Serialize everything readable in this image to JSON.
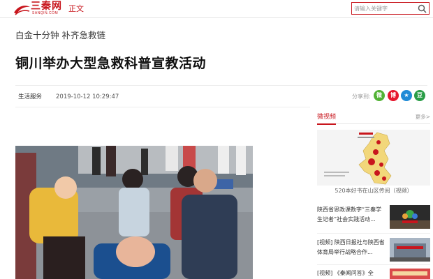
{
  "header": {
    "logo_text": "三秦网",
    "logo_sub": "SANQIN.COM",
    "nav_label": "正文",
    "search_placeholder": "请输入关键字",
    "search_icon": "search-icon",
    "brand_color": "#c8161d"
  },
  "article": {
    "kicker": "白金十分钟 补齐急救链",
    "title": "铜川举办大型急救科普宣教活动",
    "category": "生活服务",
    "datetime": "2019-10-12 10:29:47",
    "share_label": "分享到:",
    "share_buttons": [
      {
        "icon": "wechat-icon",
        "glyph": "微",
        "color": "#52b235"
      },
      {
        "icon": "weibo-icon",
        "glyph": "博",
        "color": "#e6162d"
      },
      {
        "icon": "qzone-icon",
        "glyph": "★",
        "color": "#1f8bd6"
      },
      {
        "icon": "douban-icon",
        "glyph": "豆",
        "color": "#2a9d47"
      }
    ]
  },
  "sidebar": {
    "section_title": "微视频",
    "more_label": "更多>",
    "featured_caption": "520本好书在山区传阅（视频）",
    "items": [
      {
        "text": "陕西省思政课数字“三秦学生记者”社会实践活动..."
      },
      {
        "text": "[视频] 陕西日报社与陕西省体育局举行战略合作..."
      },
      {
        "text": "[视频] 《秦闻问答》全"
      }
    ]
  }
}
